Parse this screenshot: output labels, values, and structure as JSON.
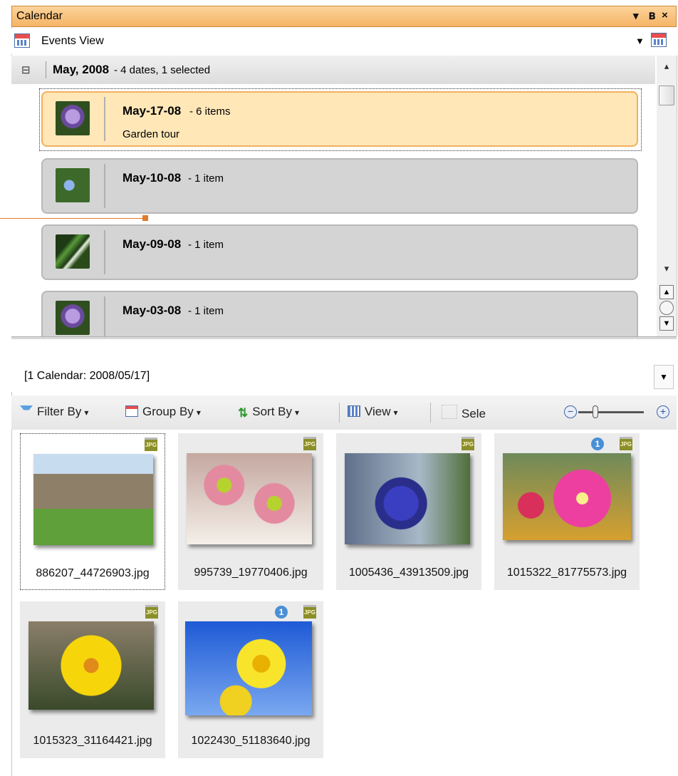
{
  "window": {
    "title": "Calendar",
    "buttons": {
      "dropdown": "▾",
      "pin": "ᵖ",
      "close": "×"
    }
  },
  "view_selector": {
    "label": "Events View"
  },
  "group": {
    "title": "May, 2008",
    "description": "- 4 dates, 1 selected",
    "toggle": "⊟"
  },
  "events": [
    {
      "date": "May-17-08",
      "count": "- 6 items",
      "name": "Garden tour",
      "selected": true,
      "thumb_color": "#7a5aa8"
    },
    {
      "date": "May-10-08",
      "count": "- 1 item",
      "name": "",
      "selected": false,
      "thumb_color": "#4d7ab8"
    },
    {
      "date": "May-09-08",
      "count": "- 1 item",
      "name": "",
      "selected": false,
      "thumb_color": "#3e6b2e"
    },
    {
      "date": "May-03-08",
      "count": "- 1 item",
      "name": "",
      "selected": false,
      "thumb_color": "#7a5aa8"
    }
  ],
  "path": {
    "label": "[1 Calendar: 2008/05/17]"
  },
  "toolbar": {
    "filter": "Filter By",
    "group": "Group By",
    "sort": "Sort By",
    "view": "View",
    "select": "Sele"
  },
  "photos": [
    {
      "file": "886207_44726903.jpg",
      "type": "JPG",
      "badge": ""
    },
    {
      "file": "995739_19770406.jpg",
      "type": "JPG",
      "badge": ""
    },
    {
      "file": "1005436_43913509.jpg",
      "type": "JPG",
      "badge": ""
    },
    {
      "file": "1015322_81775573.jpg",
      "type": "JPG",
      "badge": "1"
    },
    {
      "file": "1015323_31164421.jpg",
      "type": "JPG",
      "badge": ""
    },
    {
      "file": "1022430_51183640.jpg",
      "type": "JPG",
      "badge": "1"
    }
  ],
  "colors": {
    "accent": "#f5b466",
    "selection": "#ffe7b8",
    "connector": "#e07b2a"
  }
}
